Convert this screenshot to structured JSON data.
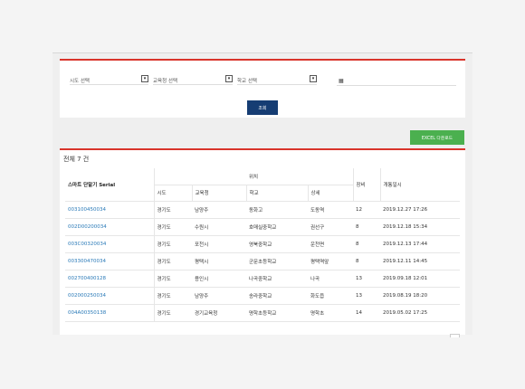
{
  "filters": {
    "sido_label": "시도 선택",
    "office_label": "교육청 선택",
    "school_label": "학교 선택",
    "date_value": "",
    "search_label": "조회"
  },
  "excel_label": "EXCEL 다운로드",
  "total_label": "전체 7 건",
  "table": {
    "serial_header": "스마트 단말기 Serial",
    "location_header": "위치",
    "count_header": "장비",
    "date_header": "개통일시",
    "sub_headers": [
      "시도",
      "교육청",
      "학교",
      "상세"
    ],
    "rows": [
      {
        "serial": "003100450034",
        "sido": "경기도",
        "office": "남양주",
        "school": "동화고",
        "detail": "도동역",
        "count": "12",
        "date": "2019.12.27 17:26"
      },
      {
        "serial": "002D00200034",
        "sido": "경기도",
        "office": "수원시",
        "school": "호매실중학교",
        "detail": "권선구",
        "count": "8",
        "date": "2019.12.18 15:34"
      },
      {
        "serial": "003C00320034",
        "sido": "경기도",
        "office": "포천시",
        "school": "영북중학교",
        "detail": "운천면",
        "count": "8",
        "date": "2019.12.13 17:44"
      },
      {
        "serial": "003300470034",
        "sido": "경기도",
        "office": "평택시",
        "school": "군문초등학교",
        "detail": "평택역앞",
        "count": "8",
        "date": "2019.12.11 14:45"
      },
      {
        "serial": "002700400128",
        "sido": "경기도",
        "office": "용인시",
        "school": "나곡중학교",
        "detail": "나곡",
        "count": "13",
        "date": "2019.09.18 12:01"
      },
      {
        "serial": "002000250034",
        "sido": "경기도",
        "office": "남양주",
        "school": "송라중학교",
        "detail": "화도읍",
        "count": "13",
        "date": "2019.08.19 18:20"
      },
      {
        "serial": "004A00350138",
        "sido": "경기도",
        "office": "경기교육청",
        "school": "명학초등학교",
        "detail": "명학초",
        "count": "14",
        "date": "2019.05.02 17:25"
      }
    ]
  },
  "colors": {
    "accent_red": "#d9342b",
    "primary_blue": "#163d73",
    "excel_green": "#4bb04f",
    "link_blue": "#2a7ab8"
  },
  "icons": {
    "select_caret": "▾",
    "calendar": "▦"
  }
}
